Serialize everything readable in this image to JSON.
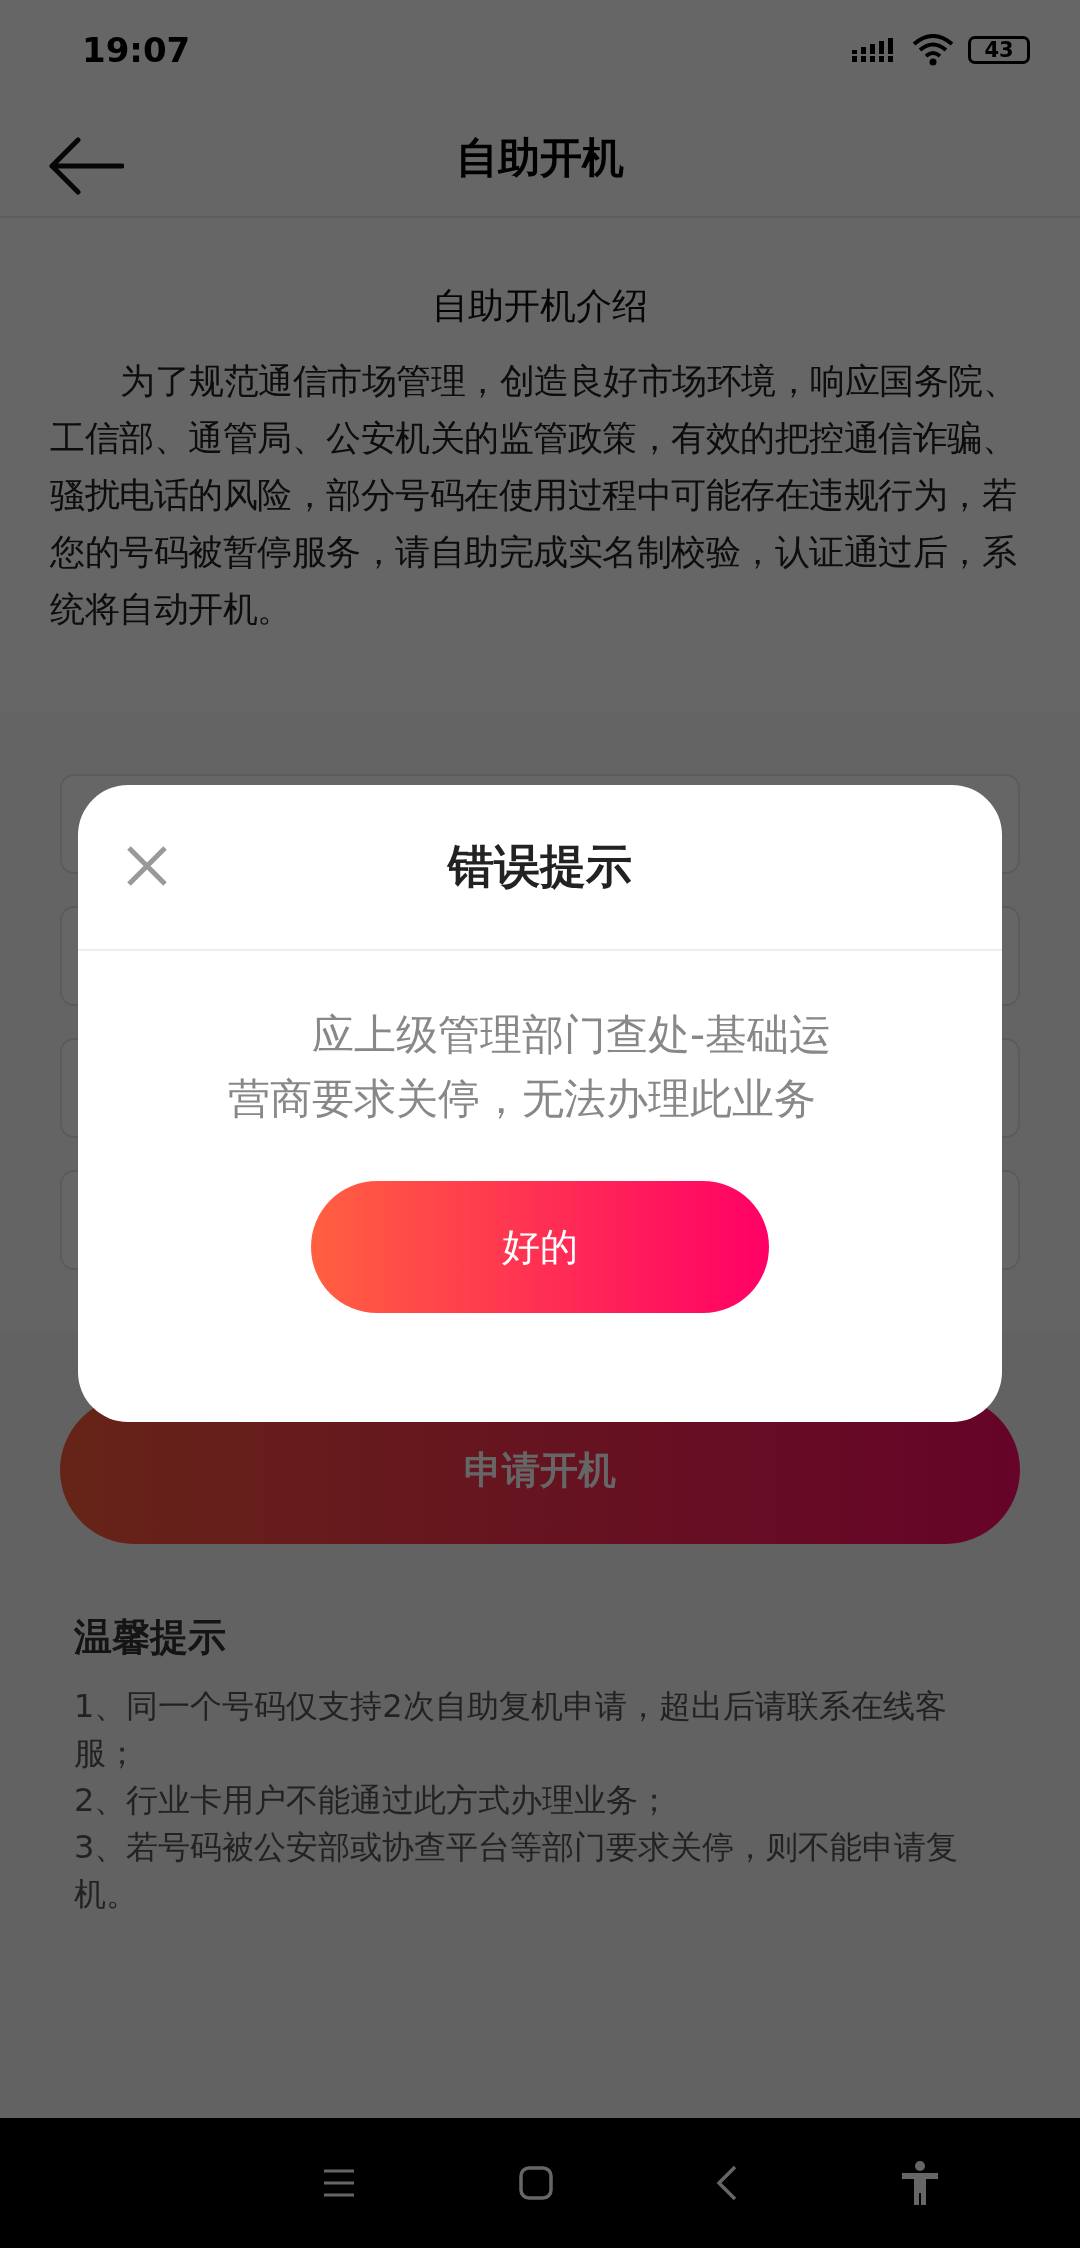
{
  "status_bar": {
    "time": "19:07",
    "battery": "43"
  },
  "header": {
    "title": "自助开机"
  },
  "intro": {
    "title": "自助开机介绍",
    "text": "为了规范通信市场管理，创造良好市场环境，响应国务院、工信部、通管局、公安机关的监管政策，有效的把控通信诈骗、骚扰电话的风险，部分号码在使用过程中可能存在违规行为，若您的号码被暂停服务，请自助完成实名制校验，认证通过后，系统将自动开机。"
  },
  "apply_button": "申请开机",
  "tips": {
    "title": "温馨提示",
    "items": [
      "1、同一个号码仅支持2次自助复机申请，超出后请联系在线客服；",
      "2、行业卡用户不能通过此方式办理业务；",
      "3、若号码被公安部或协查平台等部门要求关停，则不能申请复机。"
    ]
  },
  "dialog": {
    "title": "错误提示",
    "message": "应上级管理部门查处-基础运营商要求关停，无法办理此业务",
    "button": "好的"
  }
}
